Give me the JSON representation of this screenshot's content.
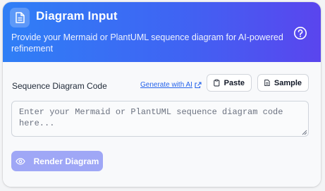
{
  "header": {
    "title": "Diagram Input",
    "subtitle": "Provide your Mermaid or PlantUML sequence diagram for AI-powered refinement",
    "icon": "document-icon",
    "help_icon": "help-circle-icon",
    "gradient_start": "#2f7ff6",
    "gradient_end": "#5a45ee"
  },
  "editor": {
    "label": "Sequence Diagram Code",
    "generate_link": "Generate with AI",
    "paste_label": "Paste",
    "sample_label": "Sample",
    "value": "",
    "placeholder": "Enter your Mermaid or PlantUML sequence diagram code here..."
  },
  "actions": {
    "render_label": "Render Diagram",
    "render_color": "#9fa7f6"
  }
}
